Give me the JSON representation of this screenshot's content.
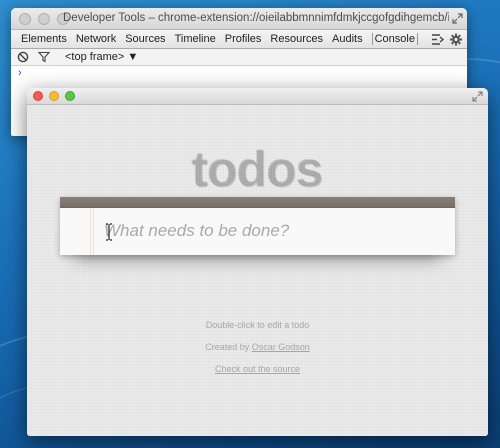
{
  "devtools": {
    "title": "Developer Tools – chrome-extension://oieilabbmnnimfdmkjccgofgdihgemcb/index.html",
    "tabs": [
      {
        "label": "Elements"
      },
      {
        "label": "Network"
      },
      {
        "label": "Sources"
      },
      {
        "label": "Timeline"
      },
      {
        "label": "Profiles"
      },
      {
        "label": "Resources"
      },
      {
        "label": "Audits"
      },
      {
        "label": "Console",
        "active": true
      }
    ],
    "frame_selector": "<top frame>",
    "prompt_symbol": "›"
  },
  "app": {
    "heading": "todos",
    "new_todo_placeholder": "What needs to be done?",
    "new_todo_value": "",
    "info": {
      "hint": "Double-click to edit a todo",
      "created_by_prefix": "Created by",
      "author": "Oscar Godson",
      "source_link": "Check out the source"
    },
    "header_color": "#7d726b"
  },
  "icons": {
    "clear_console": "no-entry-icon",
    "filter": "funnel-icon",
    "dock": "dock-toggle-icon",
    "settings": "gear-icon",
    "expand": "fullscreen-arrows-icon"
  }
}
